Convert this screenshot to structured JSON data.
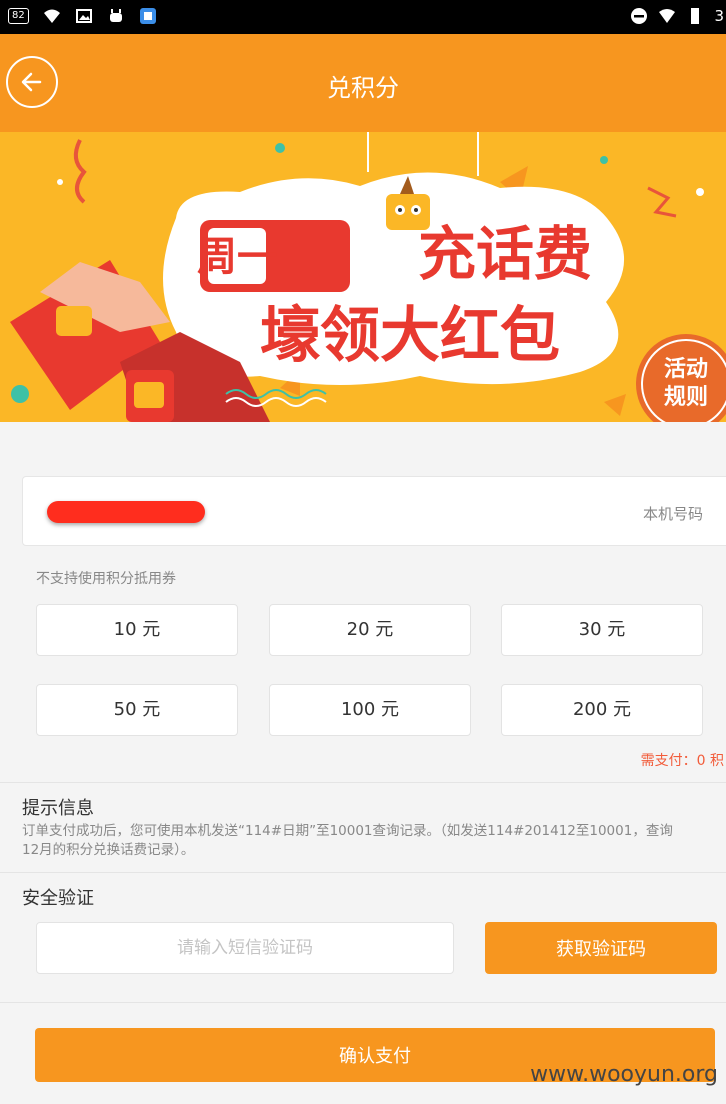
{
  "status_bar": {
    "badge": "82",
    "right_text": "3"
  },
  "header": {
    "title": "兑积分"
  },
  "banner": {
    "line1_boxed": "周一",
    "line1_rest": "充话费",
    "line2": "壕领大红包",
    "rules_line1": "活动",
    "rules_line2": "规则"
  },
  "phone": {
    "tag": "本机号码"
  },
  "note": "不支持使用积分抵用券",
  "amounts": [
    "10 元",
    "20 元",
    "30 元",
    "50 元",
    "100 元",
    "200 元"
  ],
  "payment": {
    "text": "需支付：0 积"
  },
  "tips": {
    "title": "提示信息",
    "line1": "订单支付成功后，您可使用本机发送“114#日期”至10001查询记录。（如发送114#201412至10001，查询",
    "line2": "12月的积分兑换话费记录）。"
  },
  "security": {
    "title": "安全验证",
    "code_placeholder": "请输入短信验证码",
    "get_code_label": "获取验证码"
  },
  "confirm_label": "确认支付",
  "watermark": "www.wooyun.org",
  "colors": {
    "accent": "#f7961f",
    "banner": "#fbb726",
    "price_red": "#f25c3a"
  }
}
